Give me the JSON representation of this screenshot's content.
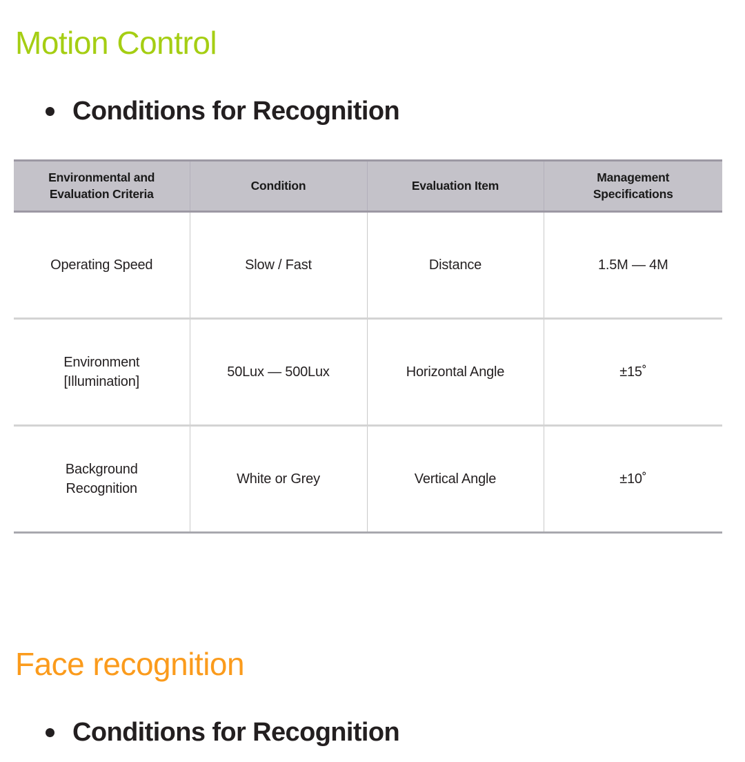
{
  "sections": [
    {
      "title": "Motion Control",
      "title_color": "#a5ce13",
      "bullet": "Conditions for Recognition"
    },
    {
      "title": "Face recognition",
      "title_color": "#fb9b1c",
      "bullet": "Conditions for Recognition"
    }
  ],
  "table": {
    "headers": [
      {
        "line1": "Environmental and",
        "line2": "Evaluation Criteria"
      },
      {
        "line1": "Condition",
        "line2": ""
      },
      {
        "line1": "Evaluation Item",
        "line2": ""
      },
      {
        "line1": "Management",
        "line2": "Specifications"
      }
    ],
    "rows": [
      {
        "criteria_line1": "Operating Speed",
        "criteria_line2": "",
        "condition": "Slow / Fast",
        "evaluation_item": "Distance",
        "management_spec": "1.5M — 4M"
      },
      {
        "criteria_line1": "Environment",
        "criteria_line2": "[Illumination]",
        "condition": "50Lux — 500Lux",
        "evaluation_item": "Horizontal Angle",
        "management_spec": "±15˚"
      },
      {
        "criteria_line1": "Background",
        "criteria_line2": "Recognition",
        "condition": "White or Grey",
        "evaluation_item": "Vertical Angle",
        "management_spec": "±10˚"
      }
    ]
  },
  "colors": {
    "header_fill": "#c4c2c9",
    "header_border": "#9c98a3",
    "body_text": "#231f20",
    "grid_line": "#c9c9c9",
    "row_line": "#d3d3d3",
    "table_bottom": "#a8a8ae"
  }
}
